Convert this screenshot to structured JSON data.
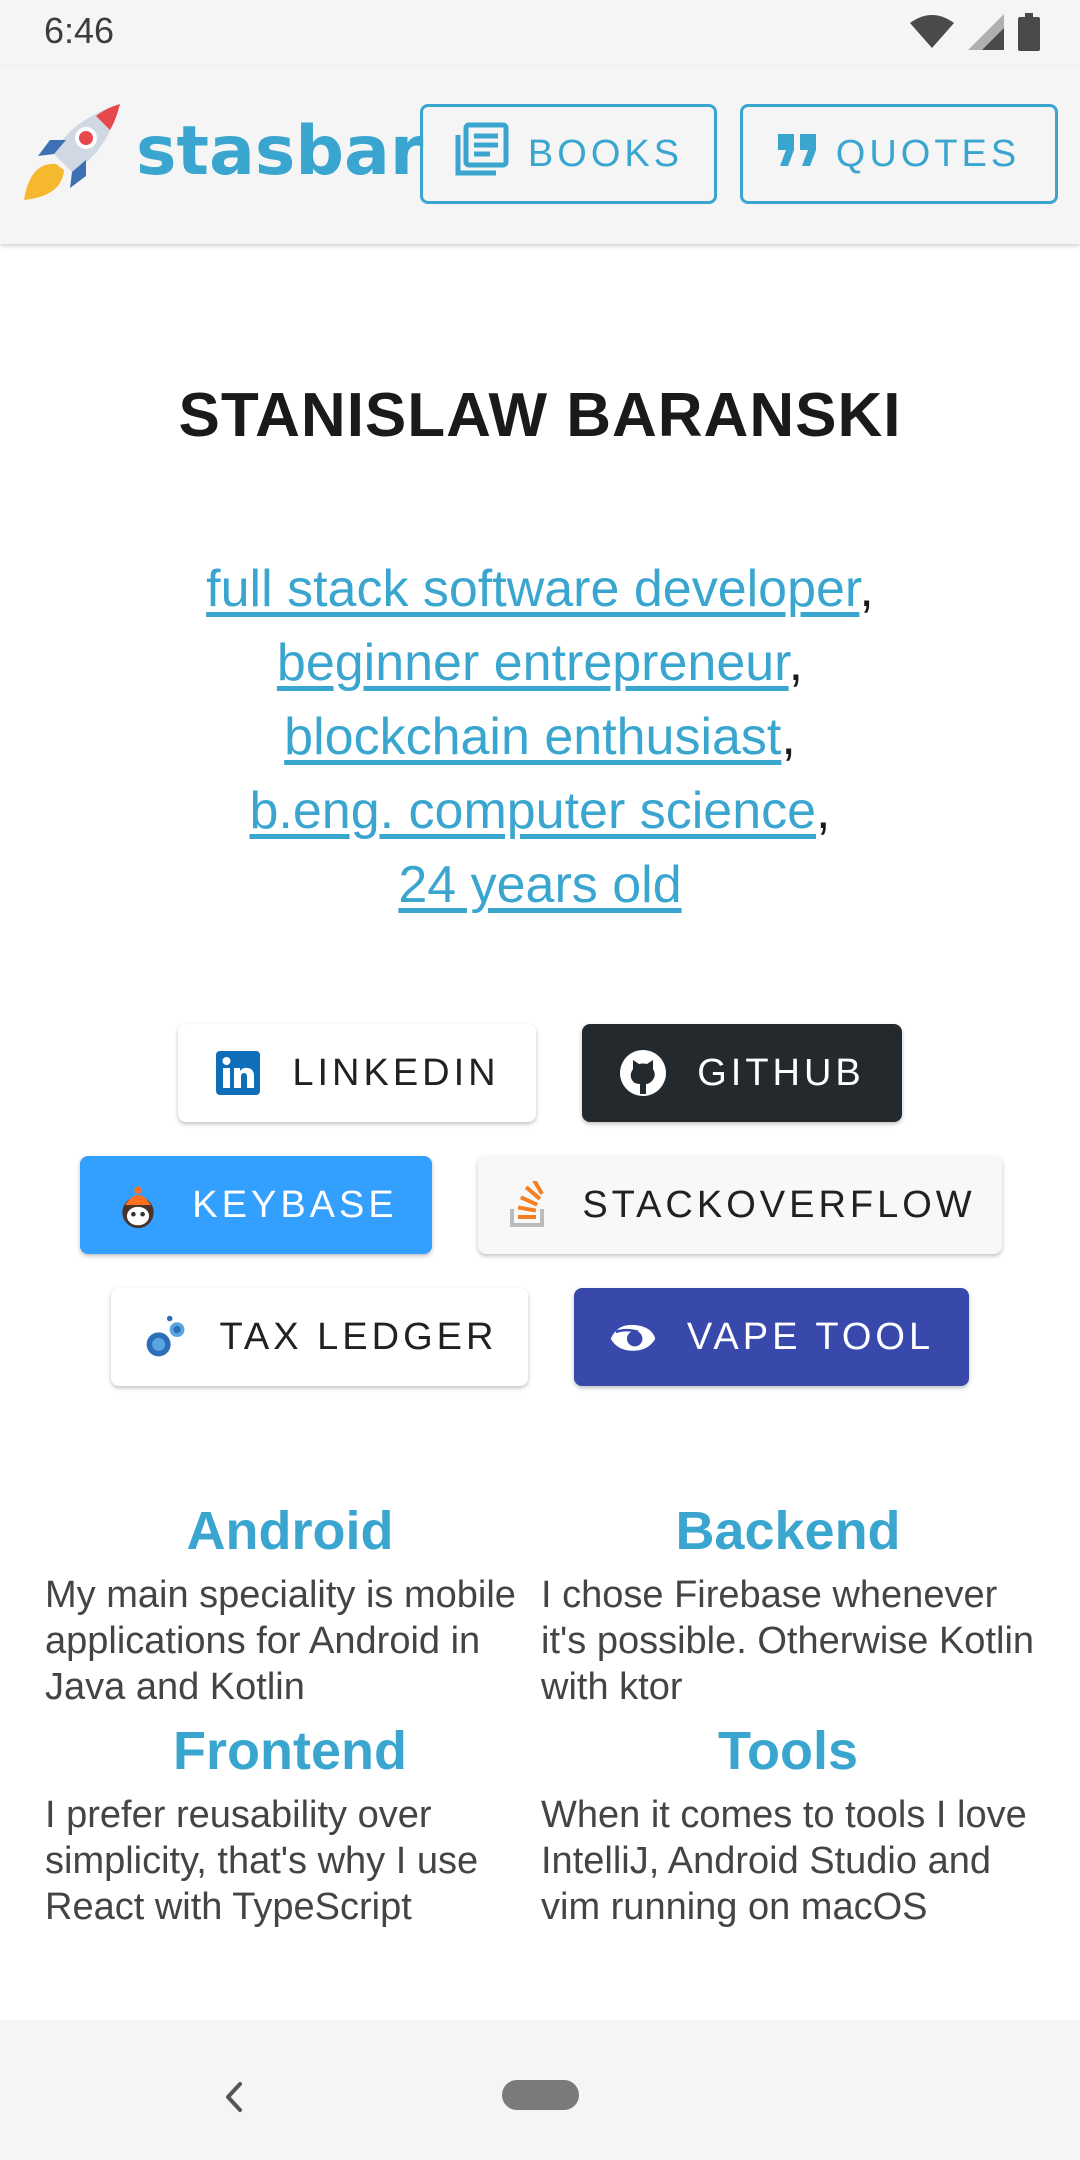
{
  "status_bar": {
    "time": "6:46"
  },
  "header": {
    "brand": "stasbar",
    "books_label": "BOOKS",
    "quotes_label": "QUOTES"
  },
  "hero": {
    "name": "STANISLAW BARANSKI",
    "roles": [
      "full stack software developer",
      "beginner entrepreneur",
      "blockchain enthusiast",
      "b.eng. computer science",
      "24 years old"
    ],
    "separator": ","
  },
  "social": {
    "linkedin": "LINKEDIN",
    "github": "GITHUB",
    "keybase": "KEYBASE",
    "stackoverflow": "STACKOVERFLOW",
    "taxledger": "TAX LEDGER",
    "vapetool": "VAPE TOOL"
  },
  "skills": [
    {
      "title": "Android",
      "text": "My main speciality is mobile applications for Android in Java and Kotlin"
    },
    {
      "title": "Backend",
      "text": "I chose Firebase whenever it's possible. Otherwise Kotlin with ktor"
    },
    {
      "title": "Frontend",
      "text": "I prefer reusability over simplicity, that's why I use React with TypeScript"
    },
    {
      "title": "Tools",
      "text": "When it comes to tools I love IntelliJ, Android Studio and vim running on macOS"
    }
  ],
  "colors": {
    "accent": "#3aa6cf",
    "github": "#24292e",
    "keybase": "#33a0ff",
    "vapetool": "#3949ab"
  },
  "icons": [
    "wifi-icon",
    "signal-icon",
    "battery-icon",
    "rocket-logo-icon",
    "book-icon",
    "quote-icon",
    "linkedin-icon",
    "github-icon",
    "keybase-icon",
    "stackoverflow-icon",
    "tax-ledger-icon",
    "vape-tool-icon",
    "back-icon",
    "home-pill-icon"
  ]
}
